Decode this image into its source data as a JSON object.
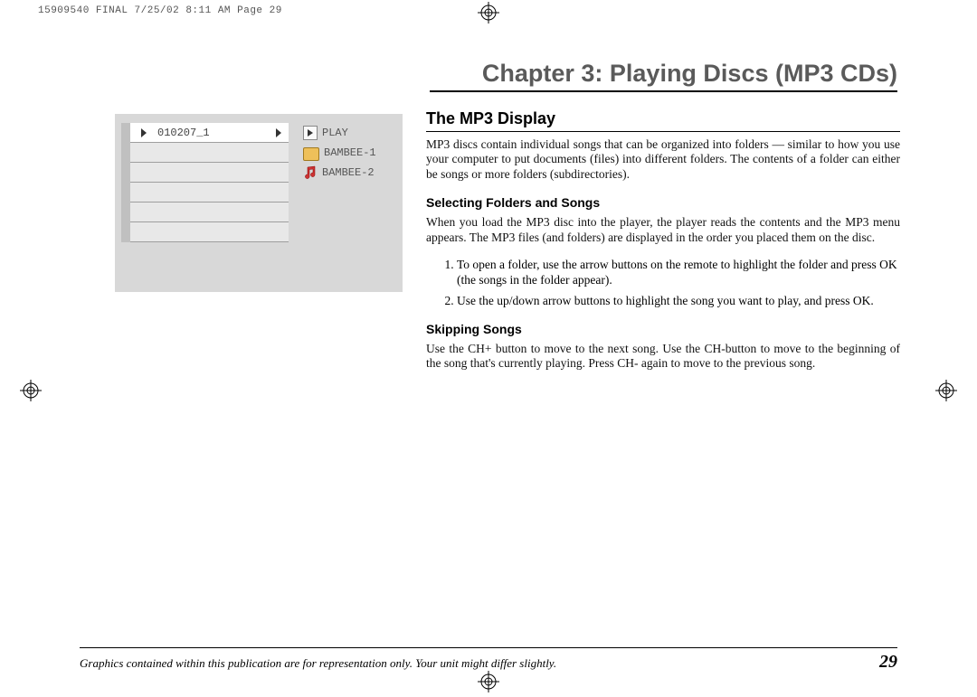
{
  "slug": "15909540 FINAL  7/25/02  8:11 AM  Page 29",
  "chapter_title": "Chapter 3: Playing Discs (MP3 CDs)",
  "figure": {
    "selected_row": "010207_1",
    "right_items": [
      {
        "type": "play",
        "label": "PLAY"
      },
      {
        "type": "folder",
        "label": "BAMBEE-1"
      },
      {
        "type": "music",
        "label": "BAMBEE-2"
      }
    ]
  },
  "body": {
    "h2": "The MP3 Display",
    "intro": "MP3 discs contain individual songs that can be organized into folders — similar to how you use your computer to put documents (files) into different folders. The contents of a folder can either be songs or more folders (subdirectories).",
    "h3a": "Selecting Folders and Songs",
    "para2": "When you load the MP3 disc into the player, the player reads the contents and the MP3 menu appears. The MP3 files (and folders) are displayed in the order you placed them on the disc.",
    "steps": [
      "To open a folder, use the arrow buttons on the remote to highlight the folder and press OK (the songs in the folder appear).",
      "Use the up/down arrow buttons to highlight the song you want to play, and press OK."
    ],
    "h3b": "Skipping Songs",
    "para3": "Use the CH+ button to move to the next song. Use the CH-button to move to the beginning of the song that's currently playing. Press CH- again to move to the previous song."
  },
  "footer": {
    "disclaimer": "Graphics contained within this publication are for representation only. Your unit might differ slightly.",
    "page": "29"
  }
}
